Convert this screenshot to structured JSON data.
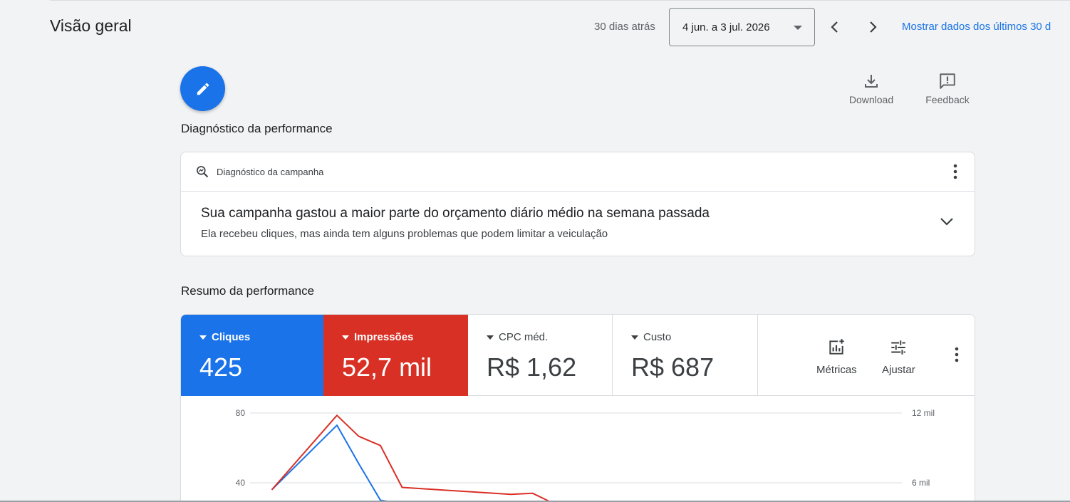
{
  "header": {
    "title": "Visão geral",
    "period_label": "30 dias atrás",
    "date_range": "4 jun. a 3 jul. 2026",
    "show_link": "Mostrar dados dos últimos 30 d"
  },
  "toolbar": {
    "download_label": "Download",
    "feedback_label": "Feedback"
  },
  "diagnostics": {
    "section_title": "Diagnóstico da performance",
    "card_label": "Diagnóstico da campanha",
    "headline": "Sua campanha gastou a maior parte do orçamento diário médio na semana passada",
    "subtext": "Ela recebeu cliques, mas ainda tem alguns problemas que podem limitar a veiculação"
  },
  "summary": {
    "section_title": "Resumo da performance",
    "metrics": [
      {
        "name": "Cliques",
        "value": "425",
        "color": "#1a73e8"
      },
      {
        "name": "Impressões",
        "value": "52,7 mil",
        "color": "#d93025"
      },
      {
        "name": "CPC méd.",
        "value": "R$ 1,62"
      },
      {
        "name": "Custo",
        "value": "R$ 687"
      }
    ],
    "metrics_button": "Métricas",
    "adjust_button": "Ajustar"
  },
  "chart_data": {
    "type": "line",
    "left_axis_ticks": [
      "80",
      "40"
    ],
    "right_axis_ticks": [
      "12 mil",
      "6 mil"
    ],
    "left_ylim": [
      0,
      80
    ],
    "right_ylim": [
      0,
      12000
    ],
    "series": [
      {
        "name": "Cliques",
        "axis": "left",
        "color": "#1a73e8",
        "points": [
          [
            1,
            36
          ],
          [
            4,
            73
          ],
          [
            5,
            51
          ],
          [
            6,
            30
          ],
          [
            7,
            28
          ]
        ]
      },
      {
        "name": "Impressões",
        "axis": "right",
        "color": "#d93025",
        "points": [
          [
            1,
            5400
          ],
          [
            4,
            11800
          ],
          [
            5,
            10000
          ],
          [
            6,
            9200
          ],
          [
            7,
            5600
          ],
          [
            12,
            5000
          ],
          [
            13,
            5100
          ],
          [
            14,
            4200
          ]
        ]
      }
    ]
  }
}
